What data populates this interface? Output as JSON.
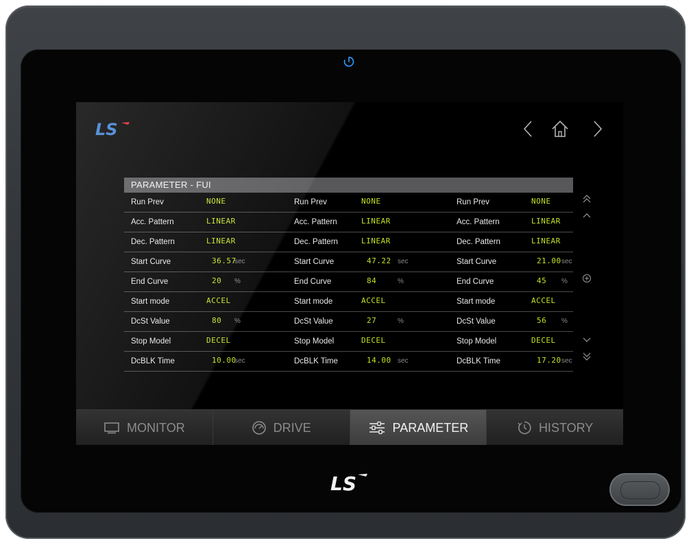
{
  "brand": {
    "logo_text": "LS"
  },
  "header": {
    "title": "PARAMETER - FUI"
  },
  "columns": [
    {
      "rows": [
        {
          "name": "Run Prev",
          "value": "NONE",
          "unit": ""
        },
        {
          "name": "Acc. Pattern",
          "value": "LINEAR",
          "unit": ""
        },
        {
          "name": "Dec. Pattern",
          "value": "LINEAR",
          "unit": ""
        },
        {
          "name": "Start Curve",
          "value": "36.57",
          "unit": "sec"
        },
        {
          "name": "End Curve",
          "value": "20",
          "unit": "%"
        },
        {
          "name": "Start mode",
          "value": "ACCEL",
          "unit": ""
        },
        {
          "name": "DcSt Value",
          "value": "80",
          "unit": "%"
        },
        {
          "name": "Stop Model",
          "value": "DECEL",
          "unit": ""
        },
        {
          "name": "DcBLK Time",
          "value": "10.00",
          "unit": "sec"
        }
      ]
    },
    {
      "rows": [
        {
          "name": "Run Prev",
          "value": "NONE",
          "unit": ""
        },
        {
          "name": "Acc. Pattern",
          "value": "LINEAR",
          "unit": ""
        },
        {
          "name": "Dec. Pattern",
          "value": "LINEAR",
          "unit": ""
        },
        {
          "name": "Start Curve",
          "value": "47.22",
          "unit": "sec"
        },
        {
          "name": "End Curve",
          "value": "84",
          "unit": "%"
        },
        {
          "name": "Start mode",
          "value": "ACCEL",
          "unit": ""
        },
        {
          "name": "DcSt Value",
          "value": "27",
          "unit": "%"
        },
        {
          "name": "Stop Model",
          "value": "DECEL",
          "unit": ""
        },
        {
          "name": "DcBLK Time",
          "value": "14.00",
          "unit": "sec"
        }
      ]
    },
    {
      "rows": [
        {
          "name": "Run Prev",
          "value": "NONE",
          "unit": ""
        },
        {
          "name": "Acc. Pattern",
          "value": "LINEAR",
          "unit": ""
        },
        {
          "name": "Dec. Pattern",
          "value": "LINEAR",
          "unit": ""
        },
        {
          "name": "Start Curve",
          "value": "21.00",
          "unit": "sec"
        },
        {
          "name": "End Curve",
          "value": "45",
          "unit": "%"
        },
        {
          "name": "Start mode",
          "value": "ACCEL",
          "unit": ""
        },
        {
          "name": "DcSt Value",
          "value": "56",
          "unit": "%"
        },
        {
          "name": "Stop Model",
          "value": "DECEL",
          "unit": ""
        },
        {
          "name": "DcBLK Time",
          "value": "17.20",
          "unit": "sec"
        }
      ]
    }
  ],
  "tabs": [
    {
      "label": "MONITOR",
      "icon": "monitor-icon",
      "active": false
    },
    {
      "label": "DRIVE",
      "icon": "gauge-icon",
      "active": false
    },
    {
      "label": "PARAMETER",
      "icon": "sliders-icon",
      "active": true
    },
    {
      "label": "HISTORY",
      "icon": "clock-icon",
      "active": false
    }
  ],
  "colors": {
    "value_text": "#c3e028",
    "logo_blue": "#3b7fd1",
    "logo_red": "#e0232a",
    "power_led": "#2f9cff"
  }
}
